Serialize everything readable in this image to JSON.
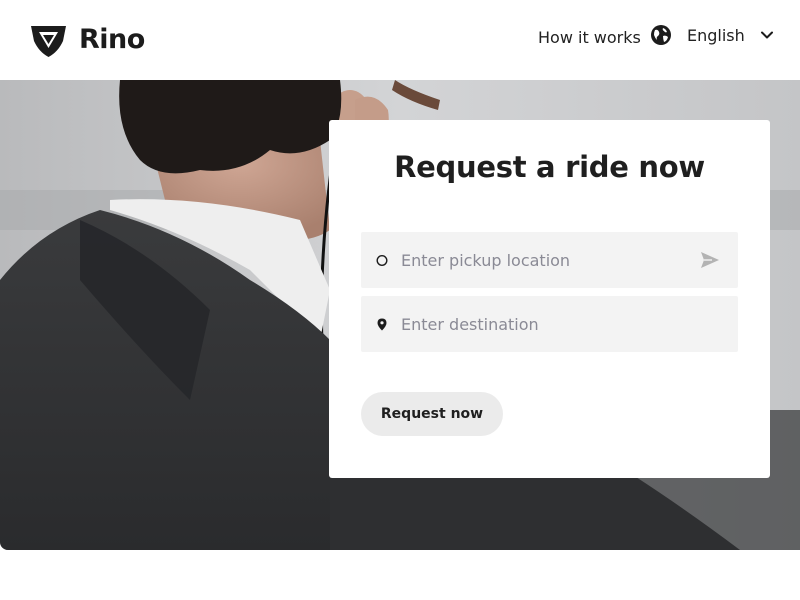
{
  "header": {
    "brand": "Rino",
    "logo_icon": "shield-logo-icon",
    "nav_link": "How it works",
    "language": {
      "icon": "globe-icon",
      "label": "English",
      "dropdown_icon": "chevron-down-icon"
    }
  },
  "hero": {
    "background": "photo-man-in-suit-with-earpiece"
  },
  "request_card": {
    "title": "Request a ride now",
    "pickup": {
      "icon": "circle-icon",
      "placeholder": "Enter pickup location",
      "value": "",
      "action_icon": "send-icon"
    },
    "destination": {
      "icon": "location-pin-icon",
      "placeholder": "Enter destination",
      "value": ""
    },
    "submit_label": "Request now"
  },
  "colors": {
    "text_dark": "#1f1f1f",
    "field_bg": "#f3f3f3",
    "button_bg": "#ebebeb",
    "placeholder": "#8a8a95"
  }
}
